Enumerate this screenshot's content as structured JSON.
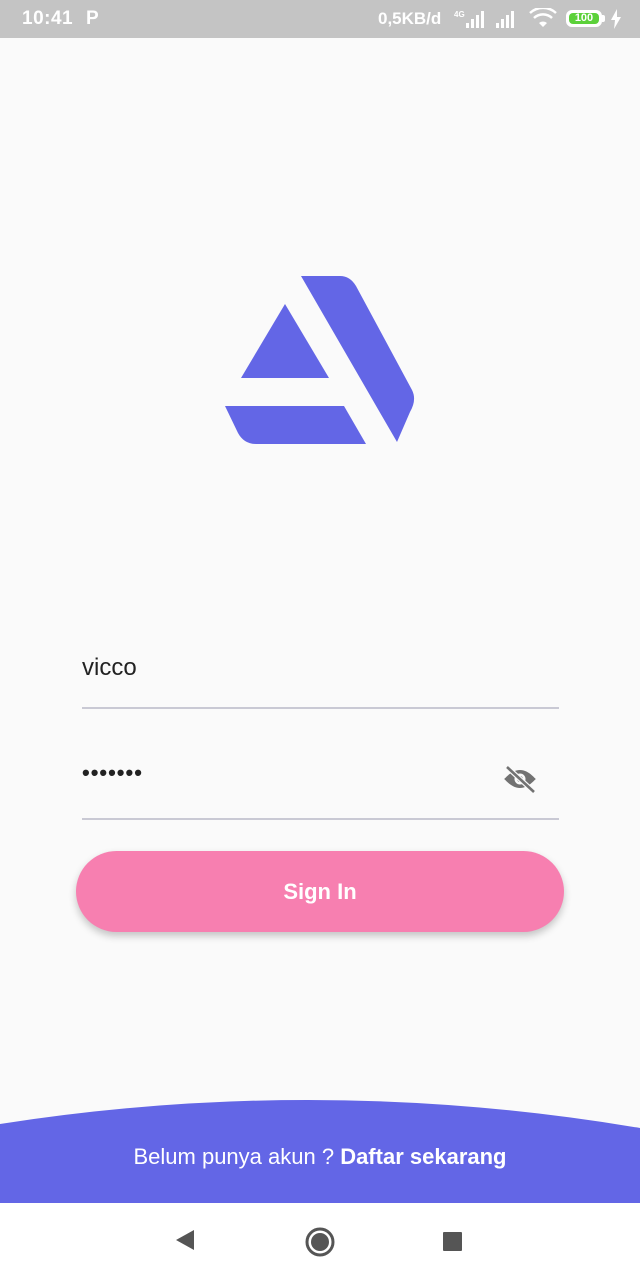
{
  "status_bar": {
    "time": "10:41",
    "notification_icon": "parking-p-icon",
    "network_speed": "0,5KB/d",
    "network_type": "4G",
    "battery_level": "100",
    "icons": [
      "signal-4g-icon",
      "signal-icon",
      "wifi-icon",
      "battery-icon",
      "charging-icon"
    ]
  },
  "logo": {
    "icon": "app-logo-icon",
    "color": "#6366e6"
  },
  "form": {
    "username_value": "vicco",
    "password_value": "•••••••",
    "password_toggle_icon": "eye-off-icon",
    "signin_label": "Sign In",
    "signin_color": "#f77fb0"
  },
  "footer": {
    "prompt_text": "Belum punya akun ? ",
    "register_link": "Daftar sekarang",
    "background_color": "#6366e6"
  },
  "nav_bar": {
    "buttons": [
      "back-icon",
      "home-icon",
      "recents-icon"
    ]
  }
}
